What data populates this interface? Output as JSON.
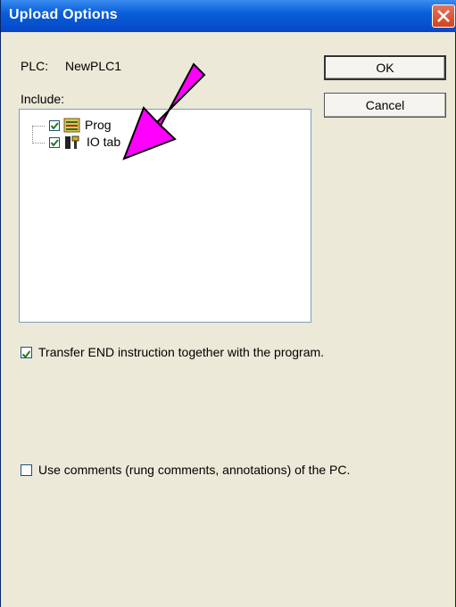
{
  "dialog": {
    "title": "Upload Options"
  },
  "plc": {
    "label": "PLC:",
    "name": "NewPLC1"
  },
  "include": {
    "label": "Include:",
    "items": [
      {
        "label": "Prog",
        "checked": true,
        "icon": "program-icon"
      },
      {
        "label": "IO tab",
        "checked": true,
        "icon": "io-table-icon"
      }
    ]
  },
  "buttons": {
    "ok": "OK",
    "cancel": "Cancel"
  },
  "options": {
    "transfer_end": {
      "label": "Transfer END instruction together with the program.",
      "checked": true
    },
    "use_comments": {
      "label": "Use comments (rung comments, annotations) of the PC.",
      "checked": false
    }
  },
  "colors": {
    "titlebar": "#0a5fd8",
    "close": "#d1431f",
    "annotation_arrow": "#ff00ff"
  }
}
